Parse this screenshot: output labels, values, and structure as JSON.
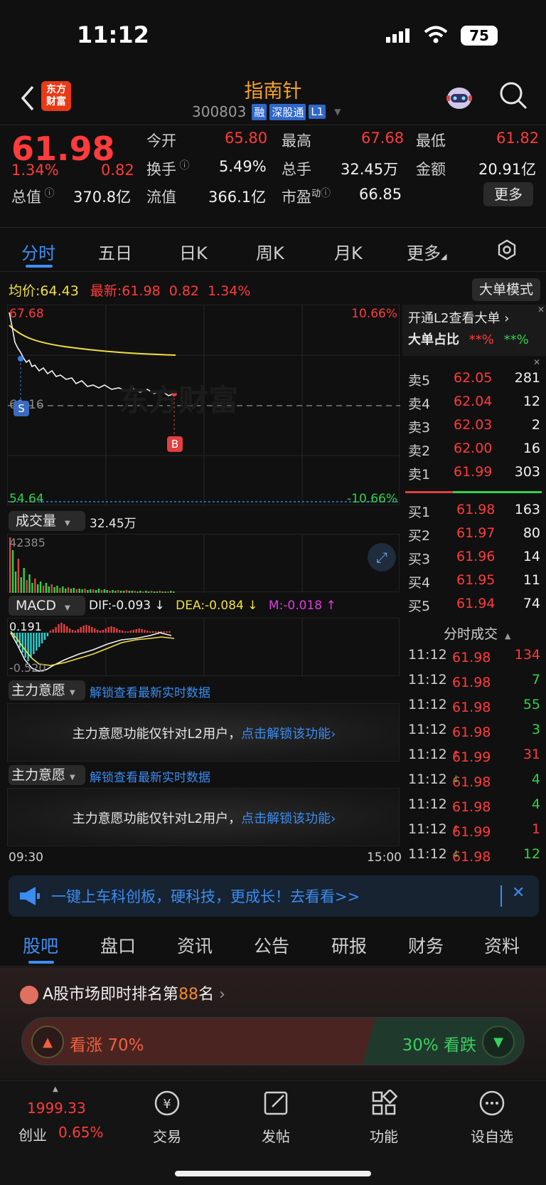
{
  "status": {
    "time": "11:12",
    "battery": "75"
  },
  "header": {
    "logo": "东方\n财富",
    "title": "指南针",
    "code": "300803",
    "badges": [
      "融",
      "深股通",
      "L1"
    ]
  },
  "quote": {
    "price": "61.98",
    "pct": "1.34%",
    "change": "0.82",
    "open_label": "今开",
    "open": "65.80",
    "high_label": "最高",
    "high": "67.68",
    "low_label": "最低",
    "low": "61.82",
    "turnover_label": "换手",
    "turnover": "5.49%",
    "volume_label": "总手",
    "volume": "32.45万",
    "amount_label": "金额",
    "amount": "20.91亿",
    "mcap_label": "总值",
    "mcap": "370.8亿",
    "float_label": "流值",
    "float": "366.1亿",
    "pe_label": "市盈",
    "pe_sup": "动",
    "pe": "66.85",
    "more": "更多"
  },
  "chart_tabs": [
    "分时",
    "五日",
    "日K",
    "周K",
    "月K",
    "更多"
  ],
  "intraday": {
    "avg_label": "均价:",
    "avg": "64.43",
    "latest_label": "最新:",
    "latest": "61.98",
    "chg": "0.82",
    "pct": "1.34%",
    "mode_btn": "大单模式",
    "y_high": "67.68",
    "y_low": "54.64",
    "y_mid": "61.16",
    "pct_high": "10.66%",
    "pct_low": "-10.66%",
    "watermark": "东方财富",
    "t_start": "09:30",
    "t_end": "15:00",
    "marker_b": "B",
    "marker_s": "S"
  },
  "volume": {
    "label": "成交量",
    "value": "32.45万",
    "max": "42385"
  },
  "macd": {
    "label": "MACD",
    "dif": "DIF:-0.093 ↓",
    "dea": "DEA:-0.084 ↓",
    "m": "M:-0.018 ↑",
    "top": "0.191",
    "bottom": "-0.520"
  },
  "zlyy": [
    {
      "label": "主力意愿",
      "link": "解锁查看最新实时数据",
      "msg": "主力意愿功能仅针对L2用户，",
      "cta": "点击解锁该功能"
    },
    {
      "label": "主力意愿",
      "link": "解锁查看最新实时数据",
      "msg": "主力意愿功能仅针对L2用户，",
      "cta": "点击解锁该功能"
    }
  ],
  "l2": {
    "promo": "开通L2查看大单",
    "ratio_label": "大单占比",
    "ratio_red": "**%",
    "ratio_green": "**%"
  },
  "orderbook": {
    "asks": [
      {
        "label": "卖5",
        "price": "62.05",
        "vol": "281"
      },
      {
        "label": "卖4",
        "price": "62.04",
        "vol": "12"
      },
      {
        "label": "卖3",
        "price": "62.03",
        "vol": "2"
      },
      {
        "label": "卖2",
        "price": "62.00",
        "vol": "16"
      },
      {
        "label": "卖1",
        "price": "61.99",
        "vol": "303"
      }
    ],
    "bids": [
      {
        "label": "买1",
        "price": "61.98",
        "vol": "163"
      },
      {
        "label": "买2",
        "price": "61.97",
        "vol": "80"
      },
      {
        "label": "买3",
        "price": "61.96",
        "vol": "14"
      },
      {
        "label": "买4",
        "price": "61.95",
        "vol": "11"
      },
      {
        "label": "买5",
        "price": "61.94",
        "vol": "74"
      }
    ]
  },
  "ticks_title": "分时成交",
  "ticks": [
    {
      "t": "11:12",
      "p": "61.98",
      "v": "134",
      "vc": "red",
      "arrow": ""
    },
    {
      "t": "11:12",
      "p": "61.98",
      "v": "7",
      "vc": "green",
      "arrow": ""
    },
    {
      "t": "11:12",
      "p": "61.98",
      "v": "55",
      "vc": "green",
      "arrow": ""
    },
    {
      "t": "11:12",
      "p": "61.98",
      "v": "3",
      "vc": "green",
      "arrow": ""
    },
    {
      "t": "11:12",
      "p": "61.99",
      "v": "31",
      "vc": "red",
      "arrow": "↑"
    },
    {
      "t": "11:12",
      "p": "61.98",
      "v": "4",
      "vc": "green",
      "arrow": "↓"
    },
    {
      "t": "11:12",
      "p": "61.98",
      "v": "4",
      "vc": "green",
      "arrow": ""
    },
    {
      "t": "11:12",
      "p": "61.99",
      "v": "1",
      "vc": "red",
      "arrow": "↑"
    },
    {
      "t": "11:12",
      "p": "61.98",
      "v": "12",
      "vc": "green",
      "arrow": "↓"
    }
  ],
  "banner": "一键上车科创板，硬科技，更成长！去看看>>",
  "info_tabs": [
    "股吧",
    "盘口",
    "资讯",
    "公告",
    "研报",
    "财务",
    "资料"
  ],
  "rank": {
    "prefix": "A股市场即时排名第",
    "num": "88",
    "suffix": "名"
  },
  "sentiment": {
    "bull_label": "看涨",
    "bull": "70%",
    "bear_label": "看跌",
    "bear": "30%",
    "bull_fraction": 0.7
  },
  "nav": {
    "index_value": "1999.33",
    "index_name": "创业",
    "index_pct": "0.65%",
    "items": [
      "交易",
      "发帖",
      "功能",
      "设自选"
    ]
  }
}
